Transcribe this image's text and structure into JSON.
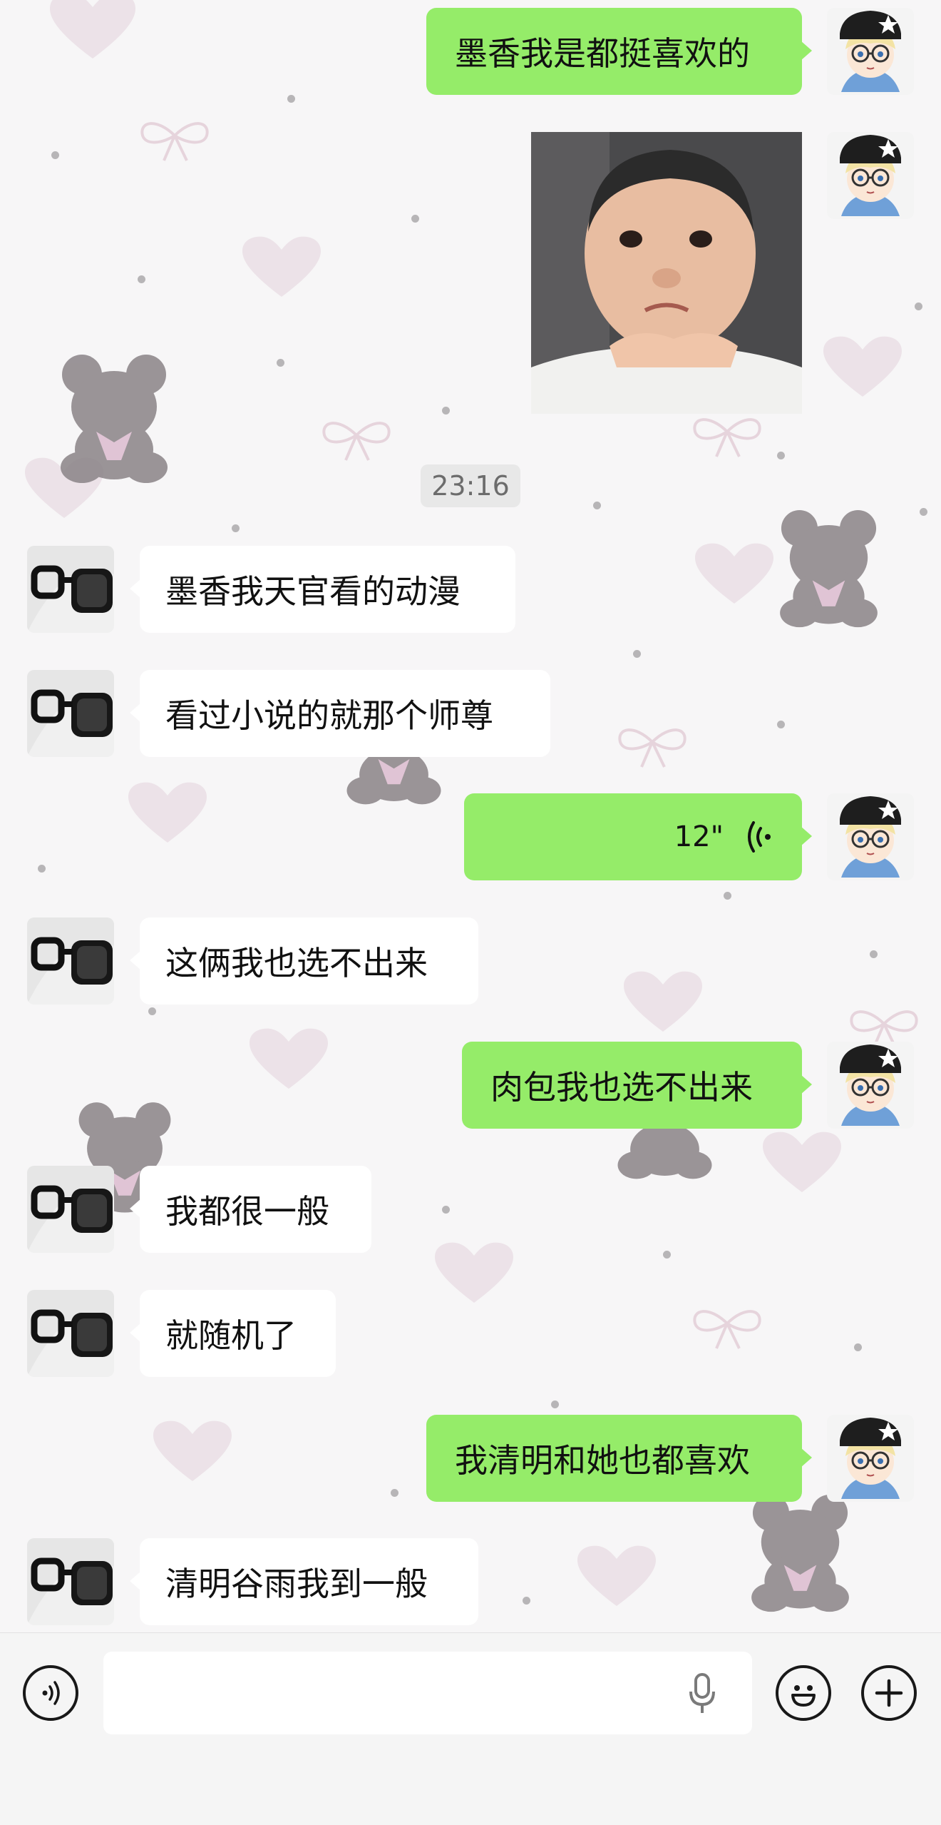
{
  "conversation": {
    "timestamp": "23:16",
    "messages": [
      {
        "side": "outgoing",
        "text": "墨香我是都挺喜欢的"
      },
      {
        "side": "outgoing",
        "type": "image",
        "text": ""
      },
      {
        "side": "incoming",
        "text": "墨香我天官看的动漫"
      },
      {
        "side": "incoming",
        "text": "看过小说的就那个师尊"
      },
      {
        "side": "outgoing",
        "type": "voice",
        "duration": "12\""
      },
      {
        "side": "incoming",
        "text": "这俩我也选不出来"
      },
      {
        "side": "outgoing",
        "text": "肉包我也选不出来"
      },
      {
        "side": "incoming",
        "text": "我都很一般"
      },
      {
        "side": "incoming",
        "text": "就随机了"
      },
      {
        "side": "outgoing",
        "text": "我清明和她也都喜欢"
      },
      {
        "side": "incoming",
        "text": "清明谷雨我到一般"
      }
    ]
  },
  "colors": {
    "outgoing_bubble": "#95ec69",
    "incoming_bubble": "#ffffff",
    "background": "#f7f6f7",
    "heart": "#e9dde3"
  },
  "input_bar": {
    "voice_toggle_icon": "voice-mode-icon",
    "mic_icon": "microphone-icon",
    "emoji_icon": "emoji-icon",
    "plus_icon": "plus-icon"
  }
}
